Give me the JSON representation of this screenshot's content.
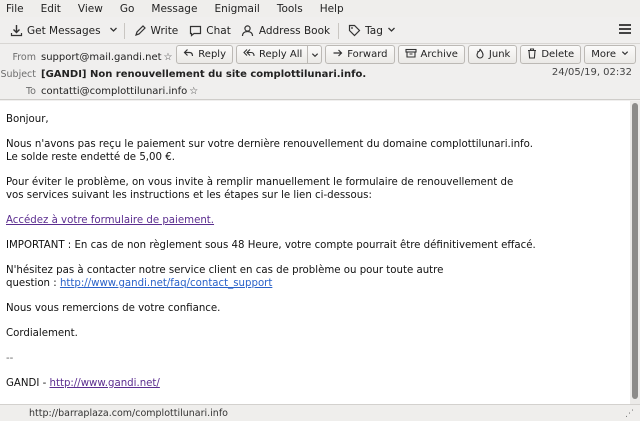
{
  "menu": [
    "File",
    "Edit",
    "View",
    "Go",
    "Message",
    "Enigmail",
    "Tools",
    "Help"
  ],
  "toolbar": {
    "get_messages": "Get Messages",
    "write": "Write",
    "chat": "Chat",
    "address_book": "Address Book",
    "tag": "Tag"
  },
  "header": {
    "from_label": "From",
    "from_value": "support@mail.gandi.net",
    "subject_label": "Subject",
    "subject_value": "[GANDI] Non renouvellement du site complottilunari.info.",
    "to_label": "To",
    "to_value": "contatti@complottilunari.info",
    "date": "24/05/19, 02:32",
    "buttons": {
      "reply": "Reply",
      "reply_all": "Reply All",
      "forward": "Forward",
      "archive": "Archive",
      "junk": "Junk",
      "delete": "Delete",
      "more": "More"
    }
  },
  "body": {
    "greeting": "Bonjour,",
    "p1_line1": "Nous n'avons pas reçu le paiement sur votre dernière renouvellement du domaine complottilunari.info.",
    "p1_line2": "Le solde reste endetté de 5,00 €.",
    "p2_line1": "Pour éviter le problème, on vous invite à remplir manuellement le formulaire de renouvellement de",
    "p2_line2": "vos services suivant les instructions et les étapes sur le lien ci-dessous:",
    "payment_link": "Accédez à votre formulaire de paiement.",
    "important": "IMPORTANT : En cas de non règlement sous 48 Heure, votre compte pourrait être définitivement effacé.",
    "p4_line1": "N'hésitez pas à contacter notre service client en cas de problème ou pour toute autre",
    "p4_prefix": "question : ",
    "support_link": "http://www.gandi.net/faq/contact_support",
    "thanks": "Nous vous remercions de votre confiance.",
    "closing": "Cordialement.",
    "sig_sep": "--",
    "sig_prefix": "GANDI - ",
    "sig_link": "http://www.gandi.net/"
  },
  "status": {
    "url": "http://barraplaza.com/complottilunari.info"
  }
}
